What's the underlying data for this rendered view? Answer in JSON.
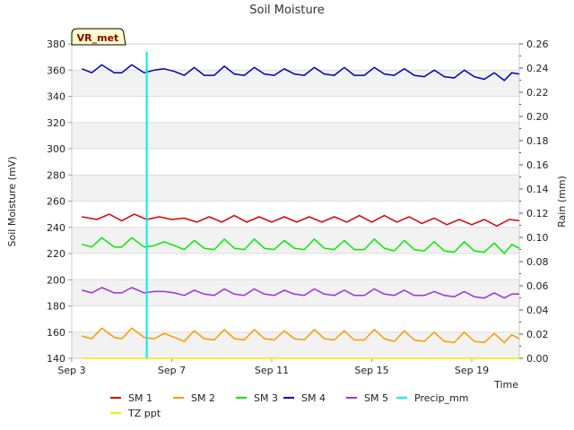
{
  "chart_data": {
    "type": "line",
    "title": "Soil Moisture",
    "xlabel": "Time",
    "ylabel": "Soil Moisture (mV)",
    "y2label": "Rain (mm)",
    "badge": "VR_met",
    "x_ticks": [
      "Sep 3",
      "Sep 7",
      "Sep 11",
      "Sep 15",
      "Sep 19"
    ],
    "xlim_days": [
      3,
      20.9
    ],
    "ylim": [
      140,
      380
    ],
    "y_ticks": [
      140,
      160,
      180,
      200,
      220,
      240,
      260,
      280,
      300,
      320,
      340,
      360,
      380
    ],
    "y2lim": [
      0,
      0.26
    ],
    "y2_ticks": [
      "0.00",
      "0.02",
      "0.04",
      "0.06",
      "0.08",
      "0.10",
      "0.12",
      "0.14",
      "0.16",
      "0.18",
      "0.20",
      "0.22",
      "0.24",
      "0.26"
    ],
    "grid": true,
    "legend_position": "bottom",
    "series": [
      {
        "name": "SM 1",
        "color": "#dd0000",
        "axis": "left",
        "points": [
          [
            3.4,
            248
          ],
          [
            4.0,
            246
          ],
          [
            4.5,
            250
          ],
          [
            5.0,
            245
          ],
          [
            5.5,
            250
          ],
          [
            6.0,
            246
          ],
          [
            6.5,
            248
          ],
          [
            7.0,
            246
          ],
          [
            7.5,
            247
          ],
          [
            8.0,
            244
          ],
          [
            8.5,
            248
          ],
          [
            9.0,
            244
          ],
          [
            9.5,
            249
          ],
          [
            10.0,
            244
          ],
          [
            10.5,
            248
          ],
          [
            11.0,
            244
          ],
          [
            11.5,
            248
          ],
          [
            12.0,
            244
          ],
          [
            12.5,
            248
          ],
          [
            13.0,
            244
          ],
          [
            13.5,
            248
          ],
          [
            14.0,
            244
          ],
          [
            14.5,
            249
          ],
          [
            15.0,
            244
          ],
          [
            15.5,
            249
          ],
          [
            16.0,
            244
          ],
          [
            16.5,
            248
          ],
          [
            17.0,
            243
          ],
          [
            17.5,
            247
          ],
          [
            18.0,
            242
          ],
          [
            18.5,
            246
          ],
          [
            19.0,
            242
          ],
          [
            19.5,
            246
          ],
          [
            20.0,
            241
          ],
          [
            20.5,
            246
          ],
          [
            20.9,
            245
          ]
        ]
      },
      {
        "name": "SM 2",
        "color": "#ff9900",
        "axis": "left",
        "points": [
          [
            3.4,
            157
          ],
          [
            3.8,
            155
          ],
          [
            4.2,
            163
          ],
          [
            4.7,
            156
          ],
          [
            5.0,
            155
          ],
          [
            5.4,
            163
          ],
          [
            5.9,
            156
          ],
          [
            6.3,
            155
          ],
          [
            6.7,
            159
          ],
          [
            7.1,
            156
          ],
          [
            7.5,
            153
          ],
          [
            7.9,
            161
          ],
          [
            8.3,
            155
          ],
          [
            8.7,
            154
          ],
          [
            9.1,
            162
          ],
          [
            9.5,
            155
          ],
          [
            9.9,
            154
          ],
          [
            10.3,
            162
          ],
          [
            10.7,
            155
          ],
          [
            11.1,
            154
          ],
          [
            11.5,
            161
          ],
          [
            11.9,
            155
          ],
          [
            12.3,
            154
          ],
          [
            12.7,
            162
          ],
          [
            13.1,
            155
          ],
          [
            13.5,
            154
          ],
          [
            13.9,
            161
          ],
          [
            14.3,
            154
          ],
          [
            14.7,
            154
          ],
          [
            15.1,
            162
          ],
          [
            15.5,
            155
          ],
          [
            15.9,
            153
          ],
          [
            16.3,
            161
          ],
          [
            16.7,
            154
          ],
          [
            17.1,
            153
          ],
          [
            17.5,
            160
          ],
          [
            17.9,
            153
          ],
          [
            18.3,
            152
          ],
          [
            18.7,
            160
          ],
          [
            19.1,
            153
          ],
          [
            19.5,
            152
          ],
          [
            19.9,
            159
          ],
          [
            20.3,
            152
          ],
          [
            20.6,
            158
          ],
          [
            20.9,
            155
          ]
        ]
      },
      {
        "name": "SM 3",
        "color": "#00ee00",
        "axis": "left",
        "points": [
          [
            3.4,
            227
          ],
          [
            3.8,
            225
          ],
          [
            4.2,
            232
          ],
          [
            4.7,
            225
          ],
          [
            5.0,
            225
          ],
          [
            5.4,
            232
          ],
          [
            5.9,
            225
          ],
          [
            6.3,
            226
          ],
          [
            6.7,
            229
          ],
          [
            7.1,
            226
          ],
          [
            7.5,
            223
          ],
          [
            7.9,
            230
          ],
          [
            8.3,
            224
          ],
          [
            8.7,
            223
          ],
          [
            9.1,
            231
          ],
          [
            9.5,
            224
          ],
          [
            9.9,
            223
          ],
          [
            10.3,
            231
          ],
          [
            10.7,
            224
          ],
          [
            11.1,
            223
          ],
          [
            11.5,
            230
          ],
          [
            11.9,
            224
          ],
          [
            12.3,
            223
          ],
          [
            12.7,
            231
          ],
          [
            13.1,
            224
          ],
          [
            13.5,
            223
          ],
          [
            13.9,
            230
          ],
          [
            14.3,
            223
          ],
          [
            14.7,
            223
          ],
          [
            15.1,
            231
          ],
          [
            15.5,
            224
          ],
          [
            15.9,
            222
          ],
          [
            16.3,
            230
          ],
          [
            16.7,
            223
          ],
          [
            17.1,
            222
          ],
          [
            17.5,
            229
          ],
          [
            17.9,
            222
          ],
          [
            18.3,
            221
          ],
          [
            18.7,
            229
          ],
          [
            19.1,
            222
          ],
          [
            19.5,
            221
          ],
          [
            19.9,
            228
          ],
          [
            20.3,
            220
          ],
          [
            20.6,
            227
          ],
          [
            20.9,
            224
          ]
        ]
      },
      {
        "name": "SM 4",
        "color": "#0000bb",
        "axis": "left",
        "points": [
          [
            3.4,
            361
          ],
          [
            3.8,
            358
          ],
          [
            4.2,
            364
          ],
          [
            4.7,
            358
          ],
          [
            5.0,
            358
          ],
          [
            5.4,
            364
          ],
          [
            5.9,
            358
          ],
          [
            6.3,
            360
          ],
          [
            6.7,
            361
          ],
          [
            7.1,
            359
          ],
          [
            7.5,
            356
          ],
          [
            7.9,
            362
          ],
          [
            8.3,
            356
          ],
          [
            8.7,
            356
          ],
          [
            9.1,
            363
          ],
          [
            9.5,
            357
          ],
          [
            9.9,
            356
          ],
          [
            10.3,
            362
          ],
          [
            10.7,
            357
          ],
          [
            11.1,
            356
          ],
          [
            11.5,
            361
          ],
          [
            11.9,
            357
          ],
          [
            12.3,
            356
          ],
          [
            12.7,
            362
          ],
          [
            13.1,
            357
          ],
          [
            13.5,
            356
          ],
          [
            13.9,
            362
          ],
          [
            14.3,
            356
          ],
          [
            14.7,
            356
          ],
          [
            15.1,
            362
          ],
          [
            15.5,
            357
          ],
          [
            15.9,
            356
          ],
          [
            16.3,
            361
          ],
          [
            16.7,
            356
          ],
          [
            17.1,
            355
          ],
          [
            17.5,
            360
          ],
          [
            17.9,
            355
          ],
          [
            18.3,
            354
          ],
          [
            18.7,
            360
          ],
          [
            19.1,
            355
          ],
          [
            19.5,
            353
          ],
          [
            19.9,
            358
          ],
          [
            20.3,
            352
          ],
          [
            20.6,
            358
          ],
          [
            20.9,
            357
          ]
        ]
      },
      {
        "name": "SM 5",
        "color": "#9933dd",
        "axis": "left",
        "points": [
          [
            3.4,
            192
          ],
          [
            3.8,
            190
          ],
          [
            4.2,
            194
          ],
          [
            4.7,
            190
          ],
          [
            5.0,
            190
          ],
          [
            5.4,
            194
          ],
          [
            5.9,
            190
          ],
          [
            6.3,
            191
          ],
          [
            6.7,
            191
          ],
          [
            7.1,
            190
          ],
          [
            7.5,
            188
          ],
          [
            7.9,
            192
          ],
          [
            8.3,
            189
          ],
          [
            8.7,
            188
          ],
          [
            9.1,
            193
          ],
          [
            9.5,
            189
          ],
          [
            9.9,
            188
          ],
          [
            10.3,
            193
          ],
          [
            10.7,
            189
          ],
          [
            11.1,
            188
          ],
          [
            11.5,
            192
          ],
          [
            11.9,
            189
          ],
          [
            12.3,
            188
          ],
          [
            12.7,
            193
          ],
          [
            13.1,
            189
          ],
          [
            13.5,
            188
          ],
          [
            13.9,
            192
          ],
          [
            14.3,
            188
          ],
          [
            14.7,
            188
          ],
          [
            15.1,
            193
          ],
          [
            15.5,
            189
          ],
          [
            15.9,
            188
          ],
          [
            16.3,
            192
          ],
          [
            16.7,
            188
          ],
          [
            17.1,
            188
          ],
          [
            17.5,
            191
          ],
          [
            17.9,
            188
          ],
          [
            18.3,
            187
          ],
          [
            18.7,
            191
          ],
          [
            19.1,
            187
          ],
          [
            19.5,
            186
          ],
          [
            19.9,
            190
          ],
          [
            20.3,
            186
          ],
          [
            20.6,
            189
          ],
          [
            20.9,
            189
          ]
        ]
      },
      {
        "name": "Precip_mm",
        "color": "#00eeee",
        "axis": "right",
        "points": [
          [
            6.0,
            0
          ],
          [
            6.0,
            0.253
          ],
          [
            6.0,
            0
          ]
        ]
      },
      {
        "name": "TZ ppt",
        "color": "#eeee00",
        "axis": "right",
        "points": [
          [
            3.4,
            0
          ],
          [
            20.9,
            0
          ]
        ]
      }
    ]
  }
}
